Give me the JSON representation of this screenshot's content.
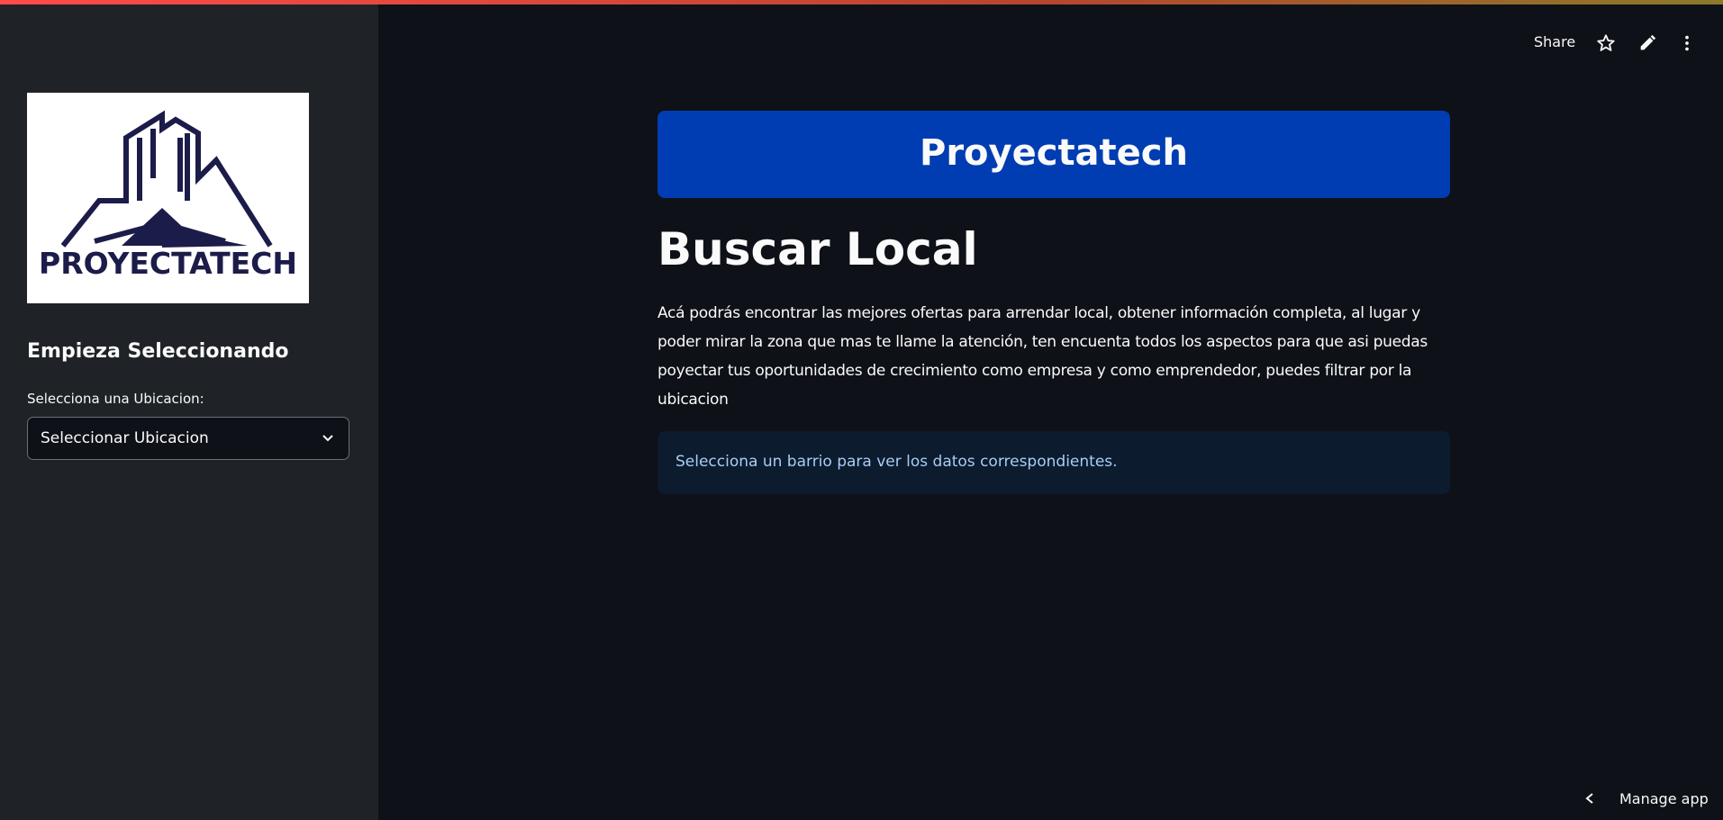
{
  "app": {
    "logo_text": "PROYECTATECH",
    "brand_color": "#003db2",
    "logo_color": "#1c1c4a"
  },
  "sidebar": {
    "heading": "Empieza Seleccionando",
    "select_label": "Selecciona una Ubicacion:",
    "select_value": "Seleccionar Ubicacion"
  },
  "header": {
    "share_label": "Share",
    "icons": [
      "star-icon",
      "edit-pencil-icon",
      "more-vertical-icon"
    ]
  },
  "main": {
    "banner_title": "Proyectatech",
    "page_title": "Buscar Local",
    "description": "Acá podrás encontrar las mejores ofertas para arrendar local, obtener información completa, al lugar y poder mirar la zona que mas te llame la atención, ten encuenta todos los aspectos para que asi puedas poyectar tus oportunidades de crecimiento como empresa y como emprendedor, puedes filtrar por la ubicacion",
    "info_message": "Selecciona un barrio para ver los datos correspondientes."
  },
  "footer": {
    "manage_app_label": "Manage app"
  }
}
